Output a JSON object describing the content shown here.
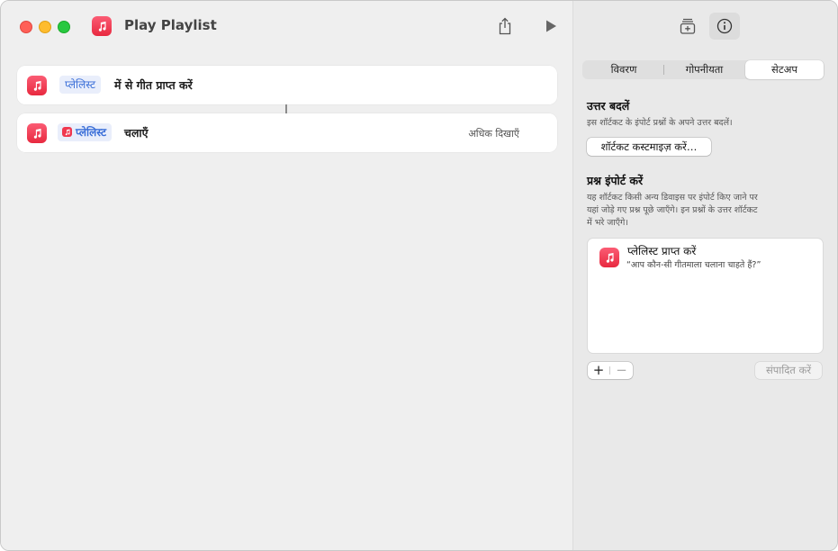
{
  "window": {
    "title": "Play Playlist"
  },
  "actions": [
    {
      "token": "प्लेलिस्ट",
      "text": "में से गीत प्राप्त करें"
    },
    {
      "token": "प्लेलिस्ट",
      "text": "चलाएँ",
      "more": "अधिक दिखाएँ"
    }
  ],
  "sidebar": {
    "tabs": [
      "विवरण",
      "गोपनीयता",
      "सेटअप"
    ],
    "selected_tab": "सेटअप",
    "answers": {
      "heading": "उत्तर बदलें",
      "description": "इस शॉर्टकट के इंपोर्ट प्रश्नों के अपने उत्तर बदलें।",
      "button": "शॉर्टकट कस्टमाइज़ करें…"
    },
    "import": {
      "heading": "प्रश्न इंपोर्ट करें",
      "desc_line1": "यह शॉर्टकट किसी अन्य डिवाइस पर इंपोर्ट किए जाने पर",
      "desc_line2": "यहां जोड़े गए प्रश्न पूछे जाएँगे। इन प्रश्नों के उत्तर शॉर्टकट",
      "desc_line3": "में भरे जाएँगे।",
      "question_title": "प्लेलिस्ट प्राप्त करें",
      "question_text": "“आप कौन-सी गीतमाला चलाना चाहते हैं?”",
      "add_symbol": "+",
      "remove_symbol": "−",
      "edit_button": "संपादित करें"
    }
  },
  "colors": {
    "accent": "#3b6fd8",
    "app_icon": "#f0384f"
  },
  "icons": [
    "music-note-icon",
    "share-icon",
    "play-icon",
    "add-to-library-icon",
    "info-icon"
  ]
}
